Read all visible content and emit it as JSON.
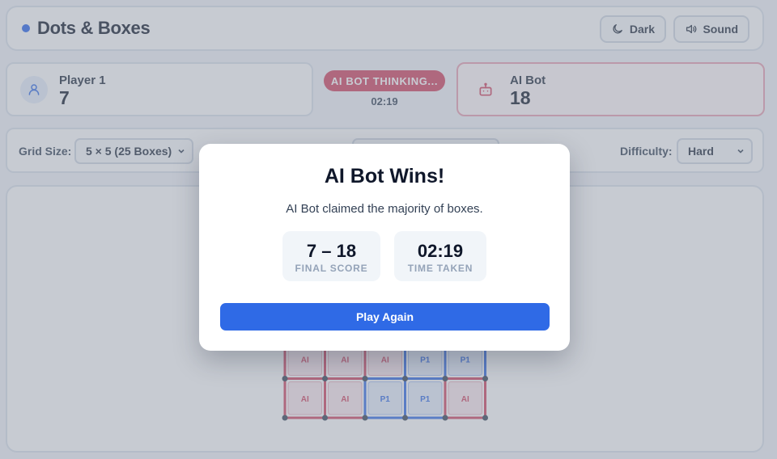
{
  "header": {
    "title": "Dots & Boxes",
    "dark_label": "Dark",
    "sound_label": "Sound"
  },
  "players": {
    "p1": {
      "name": "Player 1",
      "score": "7"
    },
    "ai": {
      "name": "AI Bot",
      "score": "18"
    }
  },
  "status": {
    "text": "AI BOT THINKING...",
    "timer": "02:19"
  },
  "controls": {
    "grid_label": "Grid Size:",
    "grid_value": "5 × 5 (25 Boxes)",
    "difficulty_label": "Difficulty:",
    "difficulty_value": "Hard"
  },
  "board": {
    "visible_rows": [
      [
        "AI",
        "AI",
        "AI",
        "P1",
        "P1"
      ],
      [
        "AI",
        "AI",
        "P1",
        "P1",
        "AI"
      ]
    ],
    "colors": {
      "ai": "#d2425f",
      "p1": "#2f6ae6"
    }
  },
  "modal": {
    "title": "AI Bot Wins!",
    "message": "AI Bot claimed the majority of boxes.",
    "score_value": "7 – 18",
    "score_label": "FINAL SCORE",
    "time_value": "02:19",
    "time_label": "TIME TAKEN",
    "button_label": "Play Again"
  }
}
